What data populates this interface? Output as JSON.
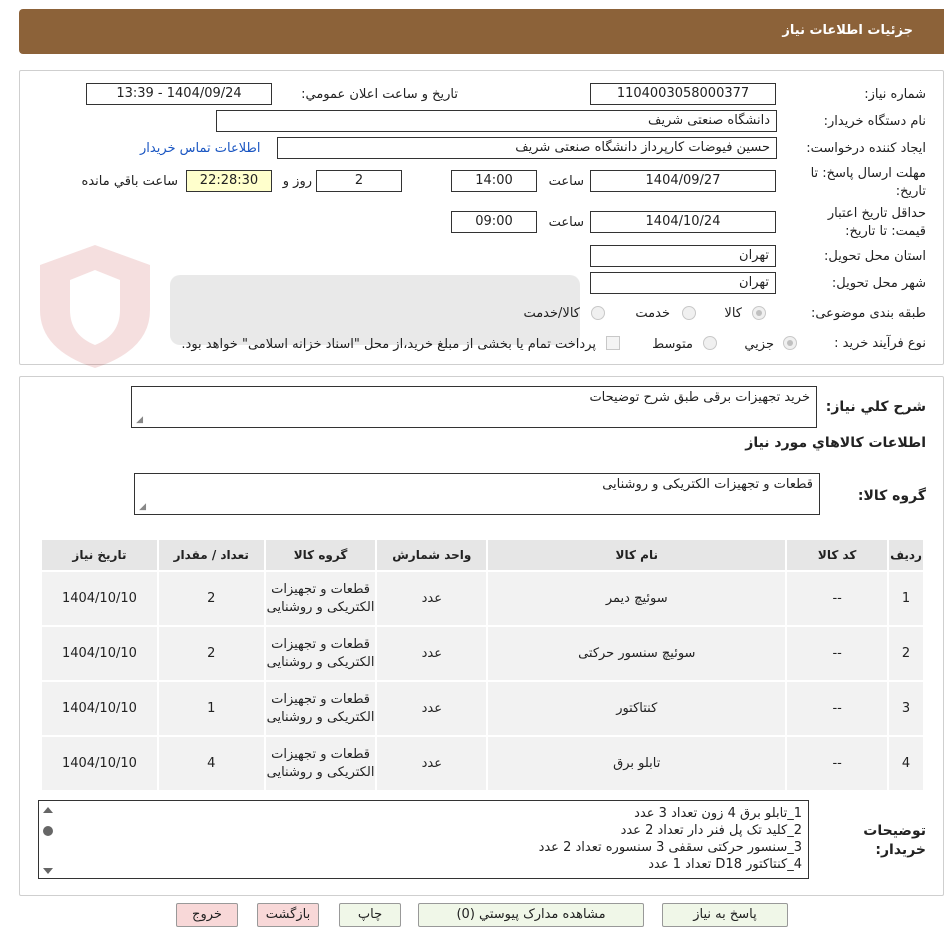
{
  "header": {
    "title": "جزئيات اطلاعات نياز"
  },
  "form": {
    "need_number_label": "شماره نياز:",
    "need_number": "1104003058000377",
    "announce_label": "تاريخ و ساعت اعلان عمومي:",
    "announce_value": "1404/09/24 - 13:39",
    "buyer_org_label": "نام دستگاه خريدار:",
    "buyer_org": "دانشگاه صنعتی شریف",
    "requester_label": "ايجاد کننده درخواست:",
    "requester": "حسین فیوضات کارپرداز دانشگاه صنعتی شریف",
    "contact_link": "اطلاعات تماس خريدار",
    "deadline_label_1": "مهلت ارسال پاسخ: تا",
    "deadline_label_2": "تاريخ:",
    "deadline_date": "1404/09/27",
    "time_label": "ساعت",
    "deadline_time": "14:00",
    "days_value": "2",
    "days_label": "روز و",
    "remaining_time": "22:28:30",
    "remaining_label": "ساعت باقي مانده",
    "validity_label_1": "حداقل تاريخ اعتبار",
    "validity_label_2": "قيمت: تا تاريخ:",
    "validity_date": "1404/10/24",
    "validity_time_label": "ساعت",
    "validity_time": "09:00",
    "province_label": "استان محل تحويل:",
    "province": "تهران",
    "city_label": "شهر محل تحويل:",
    "city": "تهران",
    "category_label": "طبقه بندی موضوعی:",
    "category_options": [
      "کالا",
      "خدمت",
      "کالا/خدمت"
    ],
    "purchase_type_label": "نوع فرآيند خريد :",
    "purchase_options": [
      "جزيي",
      "متوسط"
    ],
    "payment_note": "پرداخت تمام يا بخشی از مبلغ خريد،از محل \"اسناد خزانه اسلامی\" خواهد بود."
  },
  "summary": {
    "description_label": "شرح كلي نياز:",
    "description": "خرید تجهیزات برقی طبق شرح توضیحات",
    "goods_info_title": "اطلاعات كالاهاي مورد نياز",
    "goods_group_label": "گروه كالا:",
    "goods_group": "قطعات و تجهیزات الکتریکی و روشنایی"
  },
  "table": {
    "headers": [
      "رديف",
      "کد کالا",
      "نام کالا",
      "واحد شمارش",
      "گروه کالا",
      "تعداد / مقدار",
      "تاريخ نياز"
    ],
    "rows": [
      {
        "row": "1",
        "code": "--",
        "name": "سوئیچ دیمر",
        "unit": "عدد",
        "group": "قطعات و تجهیزات الکتریکی و روشنایی",
        "qty": "2",
        "date": "1404/10/10"
      },
      {
        "row": "2",
        "code": "--",
        "name": "سوئیچ سنسور حرکتی",
        "unit": "عدد",
        "group": "قطعات و تجهیزات الکتریکی و روشنایی",
        "qty": "2",
        "date": "1404/10/10"
      },
      {
        "row": "3",
        "code": "--",
        "name": "کنتاکتور",
        "unit": "عدد",
        "group": "قطعات و تجهیزات الکتریکی و روشنایی",
        "qty": "1",
        "date": "1404/10/10"
      },
      {
        "row": "4",
        "code": "--",
        "name": "تابلو برق",
        "unit": "عدد",
        "group": "قطعات و تجهیزات الکتریکی و روشنایی",
        "qty": "4",
        "date": "1404/10/10"
      }
    ]
  },
  "notes": {
    "label": "توضيحات خريدار:",
    "lines": [
      "1_تابلو برق 4 زون تعداد 3 عدد",
      "2_کلید تک پل فنر دار تعداد 2 عدد",
      "3_سنسور حرکتی سقفی 3 سنسوره تعداد 2 عدد",
      "4_کنتاکتور D18 تعداد 1 عدد"
    ]
  },
  "buttons": {
    "reply": "پاسخ به نياز",
    "attachments": "مشاهده مدارک پيوستي (0)",
    "print": "چاپ",
    "back": "بازگشت",
    "exit": "خروج"
  }
}
